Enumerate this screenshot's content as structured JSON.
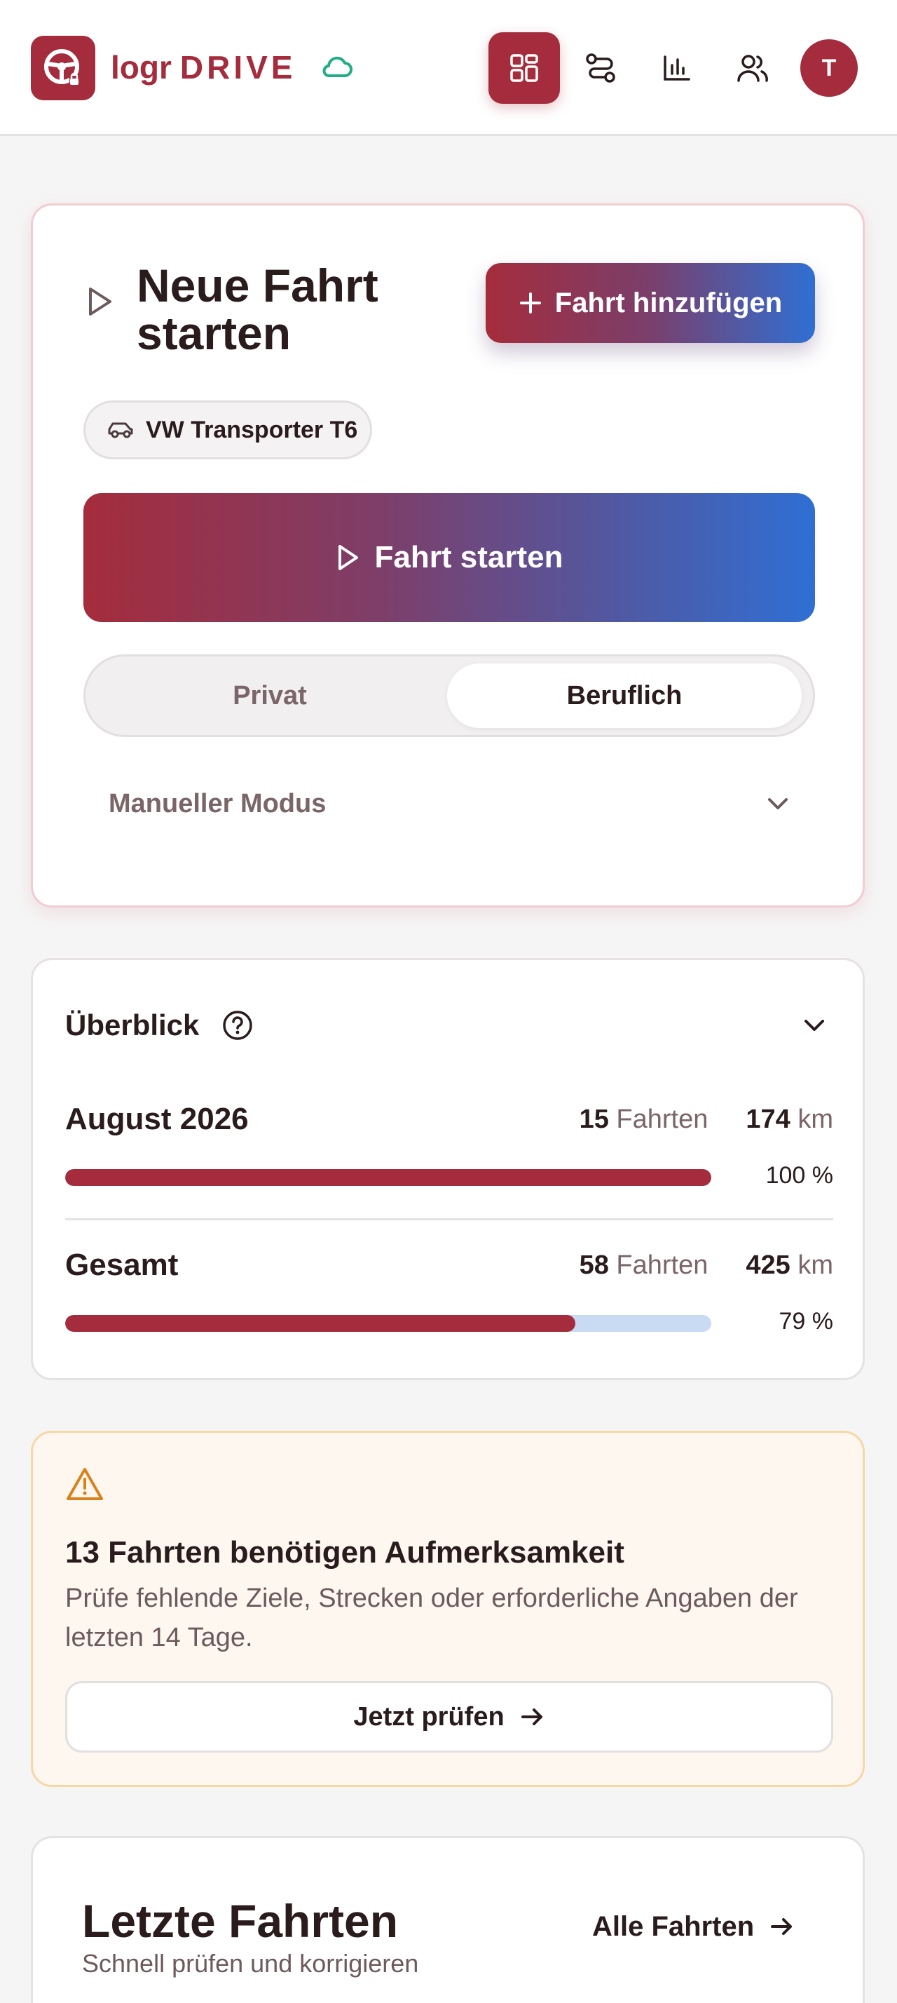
{
  "header": {
    "brand_logr": "logr",
    "brand_drive": "DRIVE",
    "avatar_initial": "T",
    "nav": [
      "dashboard-icon",
      "routes-icon",
      "stats-icon",
      "users-icon"
    ]
  },
  "start": {
    "title": "Neue Fahrt starten",
    "add_trip_label": "Fahrt hinzufügen",
    "vehicle": "VW Transporter T6",
    "start_label": "Fahrt starten",
    "toggle_private": "Privat",
    "toggle_business": "Beruflich",
    "toggle_selected": "Beruflich",
    "manual_mode": "Manueller Modus"
  },
  "overview": {
    "title": "Überblick",
    "rows": [
      {
        "label": "August 2026",
        "trips": "15",
        "trips_unit": "Fahrten",
        "km": "174",
        "km_unit": "km",
        "percent_text": "100 %",
        "fraction": 1.0
      },
      {
        "label": "Gesamt",
        "trips": "58",
        "trips_unit": "Fahrten",
        "km": "425",
        "km_unit": "km",
        "percent_text": "79 %",
        "fraction": 0.79
      }
    ]
  },
  "alert": {
    "title": "13 Fahrten benötigen Aufmerksamkeit",
    "description": "Prüfe fehlende Ziele, Strecken oder erforderliche Angaben der letzten 14 Tage.",
    "button_label": "Jetzt prüfen"
  },
  "recent": {
    "title": "Letzte Fahrten",
    "subtitle": "Schnell prüfen und korrigieren",
    "all_link": "Alle Fahrten"
  },
  "colors": {
    "brand": "#a52c3c",
    "gradient_end": "#2f6fd4",
    "cloud": "#1fae86",
    "warning": "#d9821c",
    "bar_track": "#c9dbf3"
  }
}
